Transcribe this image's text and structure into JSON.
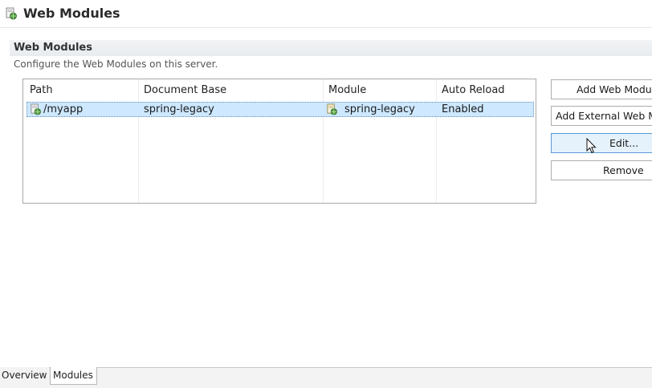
{
  "header": {
    "title": "Web Modules",
    "icon": "web-modules-icon"
  },
  "section": {
    "title": "Web Modules",
    "description": "Configure the Web Modules on this server."
  },
  "table": {
    "columns": [
      "Path",
      "Document Base",
      "Module",
      "Auto Reload"
    ],
    "rows": [
      {
        "path": "/myapp",
        "document_base": "spring-legacy",
        "module": "spring-legacy",
        "auto_reload": "Enabled",
        "selected": true
      }
    ]
  },
  "buttons": {
    "add_web_module": "Add Web Module...",
    "add_external": "Add External Web Module...",
    "edit": "Edit...",
    "remove": "Remove"
  },
  "tabs": {
    "overview": "Overview",
    "modules": "Modules",
    "active": "Modules"
  },
  "colors": {
    "selection": "#cde8ff",
    "focus_border": "#5a9bd5",
    "section_bar": "#eef0f2"
  }
}
